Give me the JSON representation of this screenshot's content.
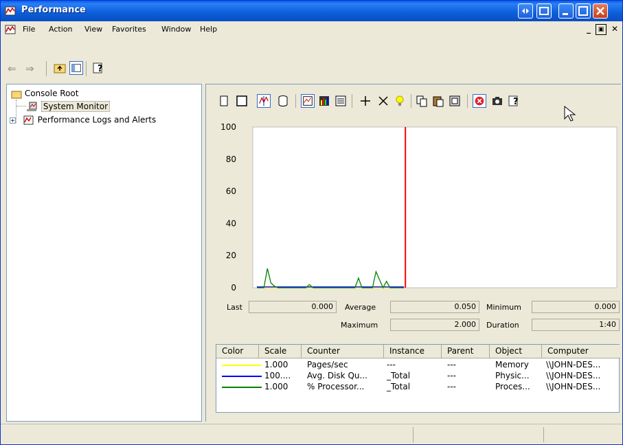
{
  "window": {
    "title": "Performance",
    "icon": "performance-app-icon"
  },
  "menubar": {
    "items": [
      "File",
      "Action",
      "View",
      "Favorites",
      "Window",
      "Help"
    ]
  },
  "tree": {
    "root": "Console Root",
    "items": [
      "System Monitor",
      "Performance Logs and Alerts"
    ],
    "selected": "System Monitor"
  },
  "chart_data": {
    "type": "line",
    "ylim": [
      0,
      100
    ],
    "yticks": [
      "100",
      "80",
      "60",
      "40",
      "20",
      "0"
    ],
    "x": [
      0,
      1,
      2,
      3,
      4,
      5,
      6,
      7,
      8,
      9,
      10,
      11,
      12,
      13,
      14,
      15,
      16,
      17,
      18,
      19,
      20,
      21,
      22,
      23,
      24,
      25,
      26,
      27,
      28,
      29,
      30,
      31,
      32,
      33,
      34,
      35,
      36,
      37,
      38,
      39,
      40,
      41,
      42
    ],
    "series": [
      {
        "color": "#ffff00",
        "values": [
          0,
          0,
          0,
          0,
          0,
          0,
          0,
          0,
          0,
          0,
          0,
          0,
          0,
          0,
          0,
          0,
          0,
          0,
          0,
          0,
          0,
          0,
          0,
          0,
          0,
          0,
          0,
          0,
          0,
          0,
          0,
          0,
          0,
          0,
          0,
          0,
          0,
          0,
          0,
          0,
          0,
          0,
          0
        ]
      },
      {
        "color": "#0000ff",
        "values": [
          0.5,
          0.5,
          0.5,
          0.5,
          0.5,
          0.5,
          0.5,
          0.5,
          0.5,
          0.5,
          0.5,
          0.5,
          0.5,
          0.5,
          0.5,
          0.5,
          0.5,
          0.5,
          0.5,
          0.5,
          0.5,
          0.5,
          0.5,
          0.5,
          0.5,
          0.5,
          0.5,
          0.5,
          0.5,
          0.5,
          0.5,
          0.5,
          0.5,
          0.5,
          0.5,
          0.5,
          0.5,
          0.5,
          0.5,
          0.5,
          0.5,
          0.5,
          0.5
        ]
      },
      {
        "color": "#008000",
        "values": [
          0,
          0,
          0,
          12,
          3,
          1,
          0,
          0,
          0,
          0,
          0,
          0,
          0,
          0,
          0,
          2,
          0,
          0,
          0,
          0,
          0,
          0,
          0,
          0,
          0,
          0,
          0,
          0,
          0,
          6,
          0,
          0,
          0,
          0,
          10,
          5,
          0,
          4,
          0,
          0,
          0,
          0,
          0
        ]
      }
    ],
    "current_position_marker_color": "#ff0000"
  },
  "stats": {
    "last_label": "Last",
    "last_value": "0.000",
    "average_label": "Average",
    "average_value": "0.050",
    "minimum_label": "Minimum",
    "minimum_value": "0.000",
    "maximum_label": "Maximum",
    "maximum_value": "2.000",
    "duration_label": "Duration",
    "duration_value": "1:40"
  },
  "legend": {
    "headers": [
      "Color",
      "Scale",
      "Counter",
      "Instance",
      "Parent",
      "Object",
      "Computer"
    ],
    "rows": [
      {
        "color": "#ffff00",
        "scale": "1.000",
        "counter": "Pages/sec",
        "instance": "---",
        "parent": "---",
        "object": "Memory",
        "computer": "\\\\JOHN-DES..."
      },
      {
        "color": "#0000ff",
        "scale": "100....",
        "counter": "Avg. Disk Qu...",
        "instance": "_Total",
        "parent": "---",
        "object": "Physic...",
        "computer": "\\\\JOHN-DES..."
      },
      {
        "color": "#008000",
        "scale": "1.000",
        "counter": "% Processor...",
        "instance": "_Total",
        "parent": "---",
        "object": "Proces...",
        "computer": "\\\\JOHN-DES..."
      }
    ]
  }
}
